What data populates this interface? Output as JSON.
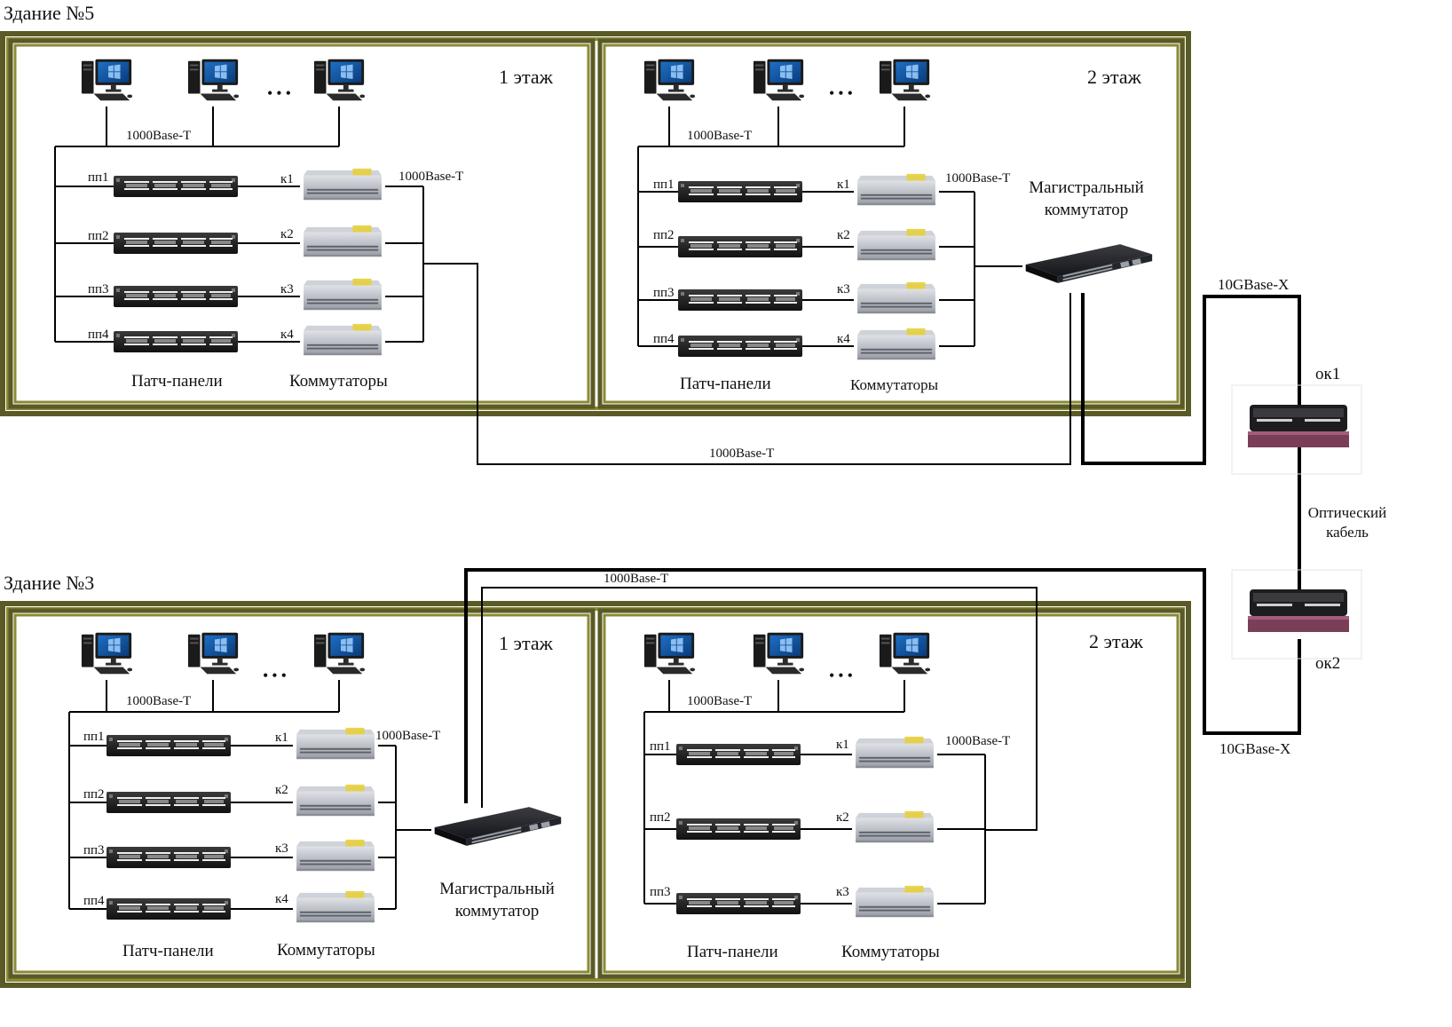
{
  "buildings": [
    {
      "title": "Здание №5",
      "floors": [
        {
          "title": "1 этаж",
          "pc_link": "1000Base-T",
          "switch_link": "1000Base-T",
          "ellipsis": "•••",
          "panels": [
            "пп1",
            "пп2",
            "пп3",
            "пп4"
          ],
          "switches": [
            "к1",
            "к2",
            "к3",
            "к4"
          ],
          "panels_caption": "Патч-панели",
          "switches_caption": "Коммутаторы"
        },
        {
          "title": "2 этаж",
          "pc_link": "1000Base-T",
          "switch_link": "1000Base-T",
          "ellipsis": "•••",
          "panels": [
            "пп1",
            "пп2",
            "пп3",
            "пп4"
          ],
          "switches": [
            "к1",
            "к2",
            "к3",
            "к4"
          ],
          "panels_caption": "Патч-панели",
          "switches_caption": "Коммутаторы",
          "core_switch": "Магистральный коммутатор"
        }
      ]
    },
    {
      "title": "Здание №3",
      "floors": [
        {
          "title": "1 этаж",
          "pc_link": "1000Base-T",
          "switch_link": "1000Base-T",
          "ellipsis": "•••",
          "panels": [
            "пп1",
            "пп2",
            "пп3",
            "пп4"
          ],
          "switches": [
            "к1",
            "к2",
            "к3",
            "к4"
          ],
          "panels_caption": "Патч-панели",
          "switches_caption": "Коммутаторы",
          "core_switch": "Магистральный коммутатор"
        },
        {
          "title": "2 этаж",
          "pc_link": "1000Base-T",
          "switch_link": "1000Base-T",
          "ellipsis": "•••",
          "panels": [
            "пп1",
            "пп2",
            "пп3"
          ],
          "switches": [
            "к1",
            "к2",
            "к3"
          ],
          "panels_caption": "Патч-панели",
          "switches_caption": "Коммутаторы"
        }
      ]
    }
  ],
  "interbuilding": {
    "uplink_b5": "1000Base-T",
    "uplink_b3": "1000Base-T",
    "fiber_top": "10GBase-X",
    "fiber_bottom": "10GBase-X",
    "ok1": "ок1",
    "ok2": "ок2",
    "optical_cable": "Оптический кабель"
  },
  "colors": {
    "frame_outer": "#5a5a26",
    "frame_inner": "#8b8a35",
    "line": "#000000",
    "rack": "#222222",
    "switch_body": "#b9bcc3",
    "switch_accent": "#e6cf3c",
    "fiber_box": "#7a3e58"
  },
  "icons": [
    "computer-icon",
    "patch-panel-icon",
    "switch-icon",
    "core-switch-icon",
    "optical-box-icon"
  ]
}
